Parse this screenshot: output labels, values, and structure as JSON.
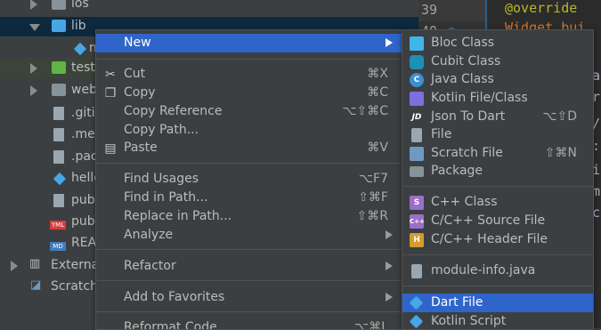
{
  "tree": {
    "items": [
      {
        "label": "ios",
        "icon": "folder-icon"
      },
      {
        "label": "lib",
        "icon": "folder-icon"
      },
      {
        "label": "m",
        "icon": "dart-file-icon"
      },
      {
        "label": "test",
        "icon": "folder-icon"
      },
      {
        "label": "web",
        "icon": "folder-icon"
      },
      {
        "label": ".giti",
        "icon": "file-icon"
      },
      {
        "label": ".me",
        "icon": "file-icon"
      },
      {
        "label": ".pac",
        "icon": "file-icon"
      },
      {
        "label": "hello",
        "icon": "dart-file-icon"
      },
      {
        "label": "pub",
        "icon": "file-icon"
      },
      {
        "label": "pub",
        "icon": "yaml-file-icon"
      },
      {
        "label": "REA",
        "icon": "markdown-file-icon"
      },
      {
        "label": "Externa",
        "icon": "library-icon"
      },
      {
        "label": "Scratch",
        "icon": "scratch-icon"
      }
    ],
    "yml_badge": "YML",
    "md_badge": "MD"
  },
  "editor": {
    "line_numbers": [
      "39",
      "40"
    ],
    "code_lines": [
      "@override",
      "Widget bui",
      "S",
      "ar",
      "r",
      "/",
      ":",
      "i",
      "ma",
      "ch"
    ]
  },
  "context_menu": {
    "items": [
      {
        "label": "New",
        "shortcut": "",
        "submenu": true,
        "highlighted": true
      },
      {
        "label": "Cut",
        "shortcut": "⌘X",
        "icon": "scissors-icon"
      },
      {
        "label": "Copy",
        "shortcut": "⌘C",
        "icon": "copy-icon"
      },
      {
        "label": "Copy Reference",
        "shortcut": "⌥⇧⌘C"
      },
      {
        "label": "Copy Path...",
        "shortcut": ""
      },
      {
        "label": "Paste",
        "shortcut": "⌘V",
        "icon": "paste-icon"
      },
      {
        "label": "Find Usages",
        "shortcut": "⌥F7"
      },
      {
        "label": "Find in Path...",
        "shortcut": "⇧⌘F"
      },
      {
        "label": "Replace in Path...",
        "shortcut": "⇧⌘R"
      },
      {
        "label": "Analyze",
        "shortcut": "",
        "submenu": true
      },
      {
        "label": "Refactor",
        "shortcut": "",
        "submenu": true
      },
      {
        "label": "Add to Favorites",
        "shortcut": "",
        "submenu": true
      },
      {
        "label": "Reformat Code",
        "shortcut": "⌥⌘L"
      }
    ],
    "glyphs": {
      "cut": "✂",
      "copy": "❐",
      "paste": "▤"
    }
  },
  "submenu_new": {
    "items": [
      {
        "label": "Bloc Class",
        "shortcut": "",
        "icon": "bloc-icon",
        "color": "#3fb6e8"
      },
      {
        "label": "Cubit Class",
        "shortcut": "",
        "icon": "cubit-icon",
        "color": "#1e8fb5"
      },
      {
        "label": "Java Class",
        "shortcut": "",
        "icon": "java-class-icon",
        "color": "#3d8fd1"
      },
      {
        "label": "Kotlin File/Class",
        "shortcut": "",
        "icon": "kotlin-icon",
        "color": "#7f6ee0"
      },
      {
        "label": "Json To Dart",
        "shortcut": "⌥⇧D",
        "icon": "json-icon",
        "color": "#1f4fd0"
      },
      {
        "label": "File",
        "shortcut": "",
        "icon": "file-icon",
        "color": "#9aa7b0"
      },
      {
        "label": "Scratch File",
        "shortcut": "⇧⌘N",
        "icon": "scratch-file-icon",
        "color": "#6e9ac2"
      },
      {
        "label": "Package",
        "shortcut": "",
        "icon": "package-icon",
        "color": "#87939a"
      },
      {
        "label": "C++ Class",
        "shortcut": "",
        "icon": "cpp-class-icon",
        "color": "#9b6fc6"
      },
      {
        "label": "C/C++ Source File",
        "shortcut": "",
        "icon": "cpp-source-icon",
        "color": "#9b6fc6"
      },
      {
        "label": "C/C++ Header File",
        "shortcut": "",
        "icon": "cpp-header-icon",
        "color": "#d69a2e"
      },
      {
        "label": "module-info.java",
        "shortcut": "",
        "icon": "module-info-icon",
        "color": "#9aa7b0"
      },
      {
        "label": "Dart File",
        "shortcut": "",
        "icon": "dart-icon",
        "color": "#47a7e5",
        "highlighted": true
      },
      {
        "label": "Kotlin Script",
        "shortcut": "",
        "icon": "kotlin-script-icon",
        "color": "#47a7e5"
      }
    ],
    "glyphs": {
      "java": "C",
      "json": "JD",
      "cpp_class": "S",
      "cpp_source": "C++",
      "cpp_header": "H"
    }
  },
  "colors": {
    "selection": "#2f65ca",
    "panel": "#3c3f41",
    "editor_bg": "#2b2b2b",
    "annotation": "#bbb529",
    "keyword": "#cc7832"
  }
}
